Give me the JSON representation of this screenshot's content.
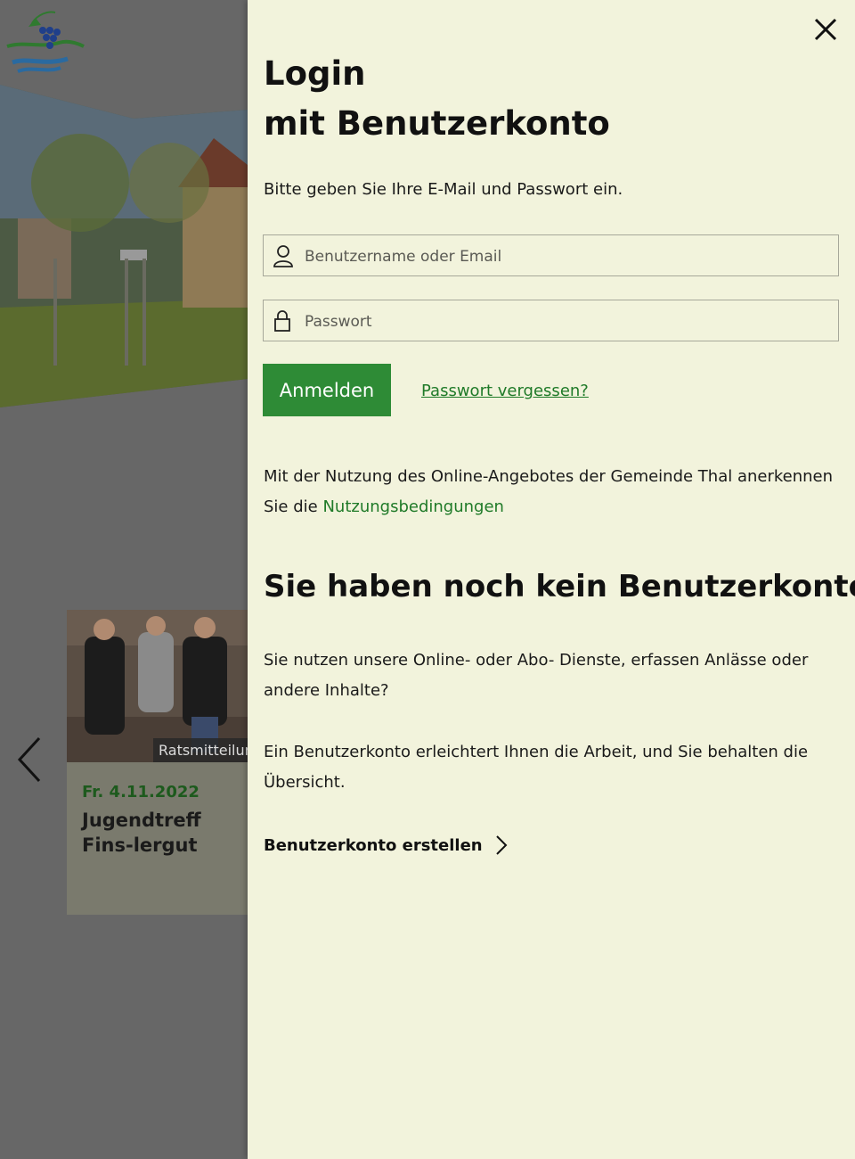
{
  "background": {
    "card": {
      "tag": "Ratsmitteilung",
      "date": "Fr. 4.11.2022",
      "title": "Jugendtreff Fins-lergut"
    }
  },
  "login": {
    "title_line1": "Login",
    "title_line2": "mit Benutzerkonto",
    "intro": "Bitte geben Sie Ihre E-Mail und Passwort ein.",
    "username_placeholder": "Benutzername oder Email",
    "password_placeholder": "Passwort",
    "submit_label": "Anmelden",
    "forgot_label": "Passwort vergessen?",
    "terms_text": "Mit der Nutzung des Online-Angebotes der Gemeinde Thal anerkennen Sie die ",
    "terms_link": "Nutzungsbedingungen"
  },
  "register": {
    "heading": "Sie haben noch kein Benutzerkonto?",
    "paragraph1": "Sie nutzen unsere Online- oder Abo- Dienste, erfassen Anlässe oder andere Inhalte?",
    "paragraph2": "Ein Benutzerkonto erleichtert Ihnen die Arbeit, und Sie behalten die Übersicht.",
    "create_label": "Benutzerkonto erstellen"
  },
  "colors": {
    "panel_bg": "#f2f3dc",
    "accent_green": "#2e8b36",
    "link_green": "#1f7a28",
    "overlay": "#676767"
  },
  "icons": {
    "close": "close-icon",
    "user": "user-icon",
    "lock": "lock-icon",
    "chevron": "chevron-right-icon",
    "prev": "chevron-left-icon"
  }
}
